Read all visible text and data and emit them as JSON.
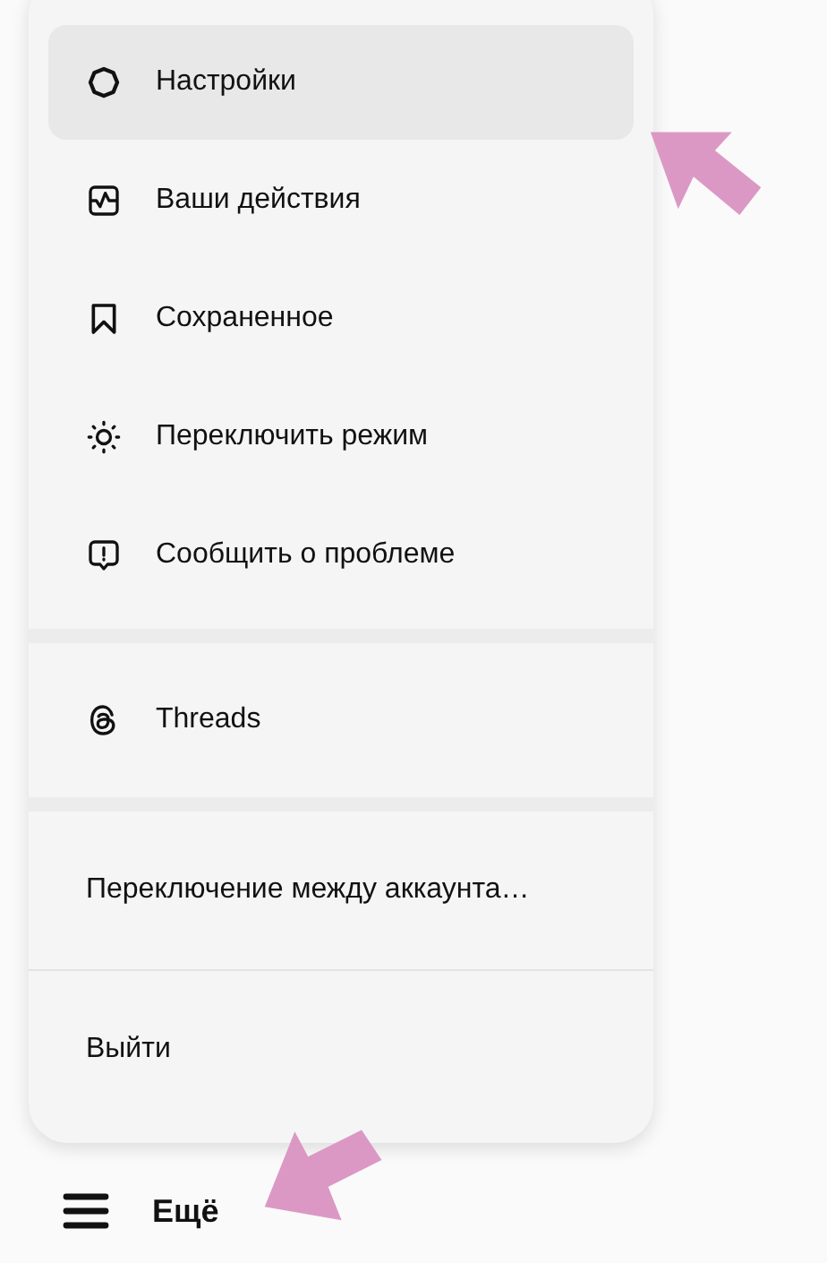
{
  "menu": {
    "sections": [
      {
        "items": [
          {
            "label": "Настройки",
            "kind": "gear",
            "selected": true
          },
          {
            "label": "Ваши действия",
            "kind": "activity",
            "selected": false
          },
          {
            "label": "Сохраненное",
            "kind": "bookmark",
            "selected": false
          },
          {
            "label": "Переключить режим",
            "kind": "sun",
            "selected": false
          },
          {
            "label": "Сообщить о проблеме",
            "kind": "report",
            "selected": false
          }
        ]
      },
      {
        "items": [
          {
            "label": "Threads",
            "kind": "threads",
            "selected": false
          }
        ]
      },
      {
        "items": [
          {
            "label": "Переключение между аккаунта…",
            "kind": "plain",
            "selected": false
          },
          {
            "label": "Выйти",
            "kind": "plain",
            "selected": false
          }
        ]
      }
    ]
  },
  "nav": {
    "label": "Ещё"
  }
}
